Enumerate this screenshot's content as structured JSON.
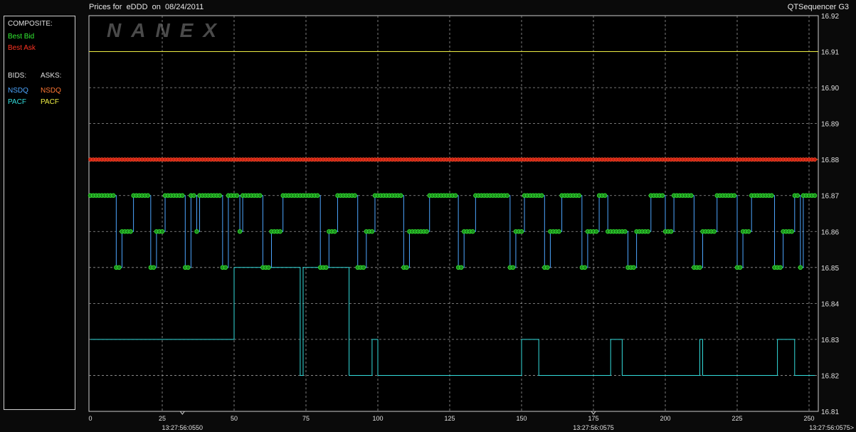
{
  "title": "Prices for  eDDD  on  08/24/2011",
  "app": "QTSequencer G3",
  "watermark": "NANEX",
  "legend": {
    "composite_label": "COMPOSITE:",
    "best_bid": "Best Bid",
    "best_ask": "Best Ask",
    "bids_label": "BIDS:",
    "asks_label": "ASKS:",
    "bids": [
      "NSDQ",
      "PACF"
    ],
    "asks": [
      "NSDQ",
      "PACF"
    ]
  },
  "colors": {
    "best_bid": "#33ee33",
    "best_ask": "#ff3322",
    "nsdq_bid": "#4da6ff",
    "pacf_bid": "#33dddd",
    "nsdq_ask": "#ff7733",
    "pacf_ask": "#eeee44"
  },
  "chart_data": {
    "type": "line",
    "xlim": [
      0,
      252
    ],
    "ylim": [
      16.81,
      16.92
    ],
    "x_ticks": [
      0,
      25,
      50,
      75,
      100,
      125,
      150,
      175,
      200,
      225,
      250
    ],
    "y_ticks": [
      16.81,
      16.82,
      16.83,
      16.84,
      16.85,
      16.86,
      16.87,
      16.88,
      16.89,
      16.9,
      16.91,
      16.92
    ],
    "time_labels": [
      {
        "x": 32,
        "text": "13:27:56:0550"
      },
      {
        "x": 175,
        "text": "13:27:56:0575"
      },
      {
        "x": 252,
        "text": "13:27:56:0575>"
      }
    ],
    "time_markers": [
      32,
      175
    ],
    "pacf_ask": 16.91,
    "nsdq_ask": 16.88,
    "best_ask": 16.88,
    "nsdq_bid": [
      [
        0,
        16.87
      ],
      [
        9,
        16.85
      ],
      [
        11,
        16.86
      ],
      [
        15,
        16.87
      ],
      [
        21,
        16.85
      ],
      [
        23,
        16.86
      ],
      [
        26,
        16.87
      ],
      [
        33,
        16.85
      ],
      [
        35,
        16.87
      ],
      [
        37,
        16.86
      ],
      [
        38,
        16.87
      ],
      [
        46,
        16.85
      ],
      [
        48,
        16.87
      ],
      [
        52,
        16.86
      ],
      [
        53,
        16.87
      ],
      [
        60,
        16.85
      ],
      [
        63,
        16.86
      ],
      [
        67,
        16.87
      ],
      [
        75,
        16.87
      ],
      [
        80,
        16.85
      ],
      [
        83,
        16.86
      ],
      [
        86,
        16.87
      ],
      [
        93,
        16.85
      ],
      [
        96,
        16.86
      ],
      [
        99,
        16.87
      ],
      [
        109,
        16.85
      ],
      [
        111,
        16.86
      ],
      [
        118,
        16.87
      ],
      [
        128,
        16.85
      ],
      [
        130,
        16.86
      ],
      [
        134,
        16.87
      ],
      [
        146,
        16.85
      ],
      [
        148,
        16.86
      ],
      [
        151,
        16.87
      ],
      [
        158,
        16.85
      ],
      [
        160,
        16.86
      ],
      [
        164,
        16.87
      ],
      [
        171,
        16.85
      ],
      [
        173,
        16.86
      ],
      [
        177,
        16.87
      ],
      [
        180,
        16.86
      ],
      [
        187,
        16.85
      ],
      [
        190,
        16.86
      ],
      [
        195,
        16.87
      ],
      [
        200,
        16.86
      ],
      [
        203,
        16.87
      ],
      [
        210,
        16.85
      ],
      [
        213,
        16.86
      ],
      [
        218,
        16.87
      ],
      [
        225,
        16.85
      ],
      [
        227,
        16.86
      ],
      [
        230,
        16.87
      ],
      [
        238,
        16.85
      ],
      [
        241,
        16.86
      ],
      [
        245,
        16.87
      ],
      [
        247,
        16.85
      ],
      [
        248,
        16.87
      ],
      [
        252,
        16.87
      ]
    ],
    "pacf_bid": [
      [
        0,
        16.83
      ],
      [
        50,
        16.83
      ],
      [
        50,
        16.85
      ],
      [
        73,
        16.85
      ],
      [
        73,
        16.82
      ],
      [
        74,
        16.82
      ],
      [
        74,
        16.85
      ],
      [
        90,
        16.85
      ],
      [
        90,
        16.82
      ],
      [
        98,
        16.82
      ],
      [
        98,
        16.83
      ],
      [
        100,
        16.83
      ],
      [
        100,
        16.82
      ],
      [
        150,
        16.82
      ],
      [
        150,
        16.83
      ],
      [
        156,
        16.83
      ],
      [
        156,
        16.82
      ],
      [
        181,
        16.82
      ],
      [
        181,
        16.83
      ],
      [
        185,
        16.83
      ],
      [
        185,
        16.82
      ],
      [
        212,
        16.82
      ],
      [
        212,
        16.83
      ],
      [
        213,
        16.83
      ],
      [
        213,
        16.82
      ],
      [
        239,
        16.82
      ],
      [
        239,
        16.83
      ],
      [
        245,
        16.83
      ],
      [
        245,
        16.82
      ],
      [
        252,
        16.82
      ]
    ]
  }
}
